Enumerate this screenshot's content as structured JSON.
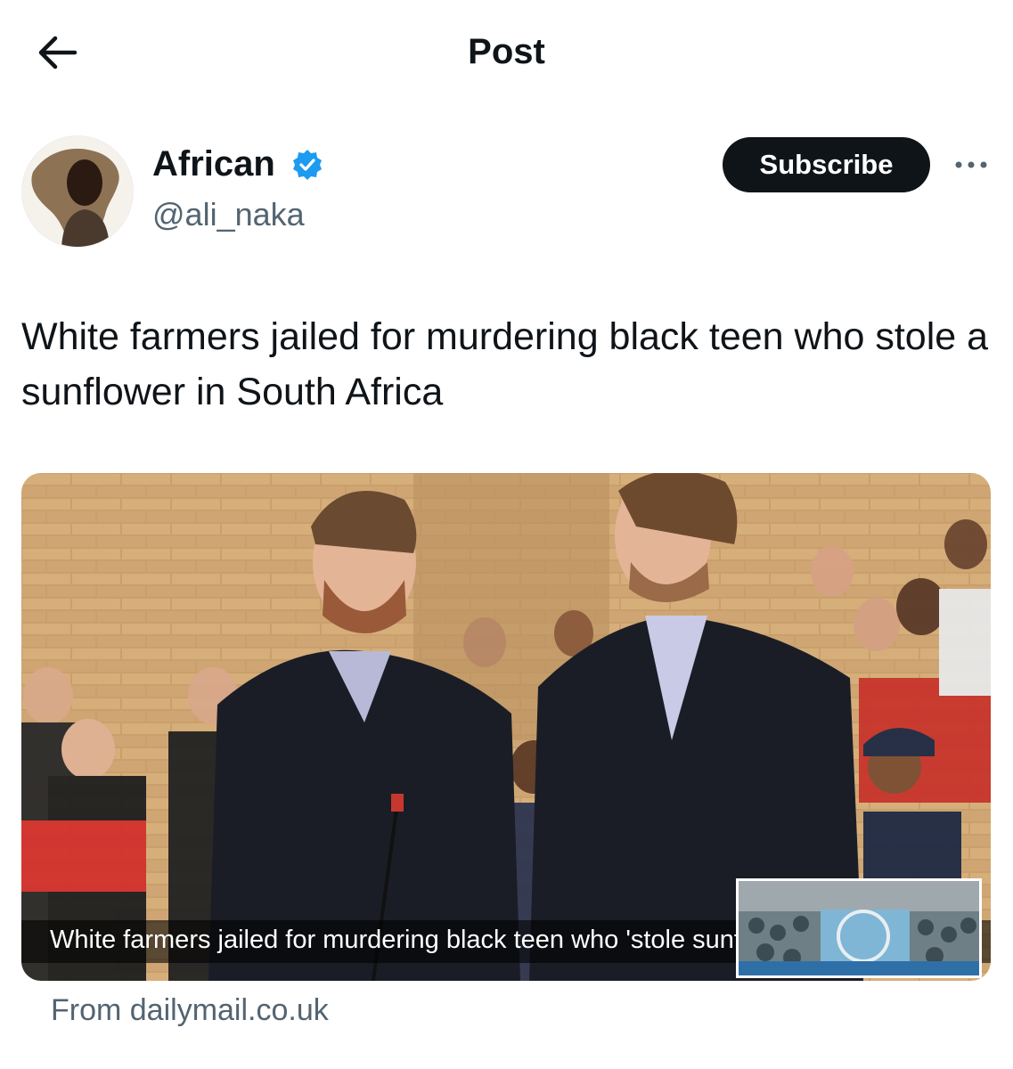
{
  "header": {
    "title": "Post",
    "back_icon": "arrow-left-icon"
  },
  "author": {
    "display_name": "African",
    "handle": "@ali_naka",
    "verified_color": "#1d9bf0",
    "subscribe_label": "Subscribe",
    "more_icon": "more-horizontal-icon"
  },
  "post": {
    "text": "White farmers jailed for murdering black teen who stole a sunflower in South Africa"
  },
  "link_card": {
    "caption": "White farmers jailed for murdering black teen who 'stole sunflowers'",
    "source": "From dailymail.co.uk"
  },
  "colors": {
    "text": "#0f1419",
    "secondary": "#536471",
    "button": "#0f1419"
  }
}
